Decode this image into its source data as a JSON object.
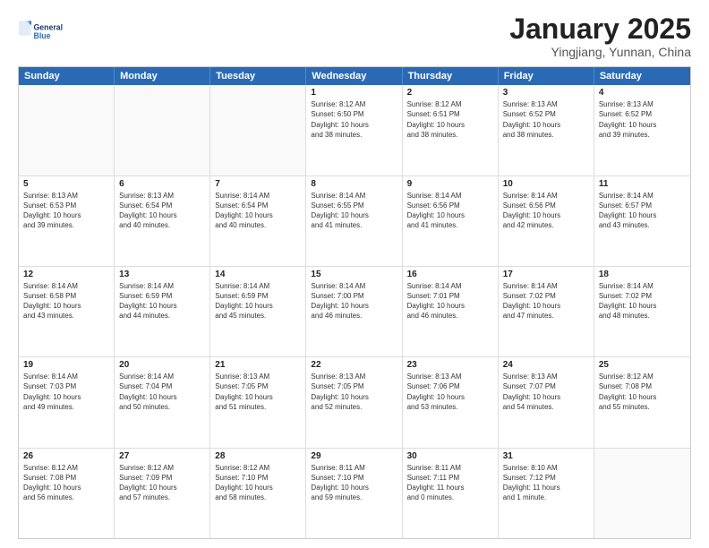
{
  "logo": {
    "line1": "General",
    "line2": "Blue"
  },
  "title": "January 2025",
  "subtitle": "Yingjiang, Yunnan, China",
  "header": {
    "days": [
      "Sunday",
      "Monday",
      "Tuesday",
      "Wednesday",
      "Thursday",
      "Friday",
      "Saturday"
    ]
  },
  "rows": [
    [
      {
        "day": "",
        "text": ""
      },
      {
        "day": "",
        "text": ""
      },
      {
        "day": "",
        "text": ""
      },
      {
        "day": "1",
        "text": "Sunrise: 8:12 AM\nSunset: 6:50 PM\nDaylight: 10 hours\nand 38 minutes."
      },
      {
        "day": "2",
        "text": "Sunrise: 8:12 AM\nSunset: 6:51 PM\nDaylight: 10 hours\nand 38 minutes."
      },
      {
        "day": "3",
        "text": "Sunrise: 8:13 AM\nSunset: 6:52 PM\nDaylight: 10 hours\nand 38 minutes."
      },
      {
        "day": "4",
        "text": "Sunrise: 8:13 AM\nSunset: 6:52 PM\nDaylight: 10 hours\nand 39 minutes."
      }
    ],
    [
      {
        "day": "5",
        "text": "Sunrise: 8:13 AM\nSunset: 6:53 PM\nDaylight: 10 hours\nand 39 minutes."
      },
      {
        "day": "6",
        "text": "Sunrise: 8:13 AM\nSunset: 6:54 PM\nDaylight: 10 hours\nand 40 minutes."
      },
      {
        "day": "7",
        "text": "Sunrise: 8:14 AM\nSunset: 6:54 PM\nDaylight: 10 hours\nand 40 minutes."
      },
      {
        "day": "8",
        "text": "Sunrise: 8:14 AM\nSunset: 6:55 PM\nDaylight: 10 hours\nand 41 minutes."
      },
      {
        "day": "9",
        "text": "Sunrise: 8:14 AM\nSunset: 6:56 PM\nDaylight: 10 hours\nand 41 minutes."
      },
      {
        "day": "10",
        "text": "Sunrise: 8:14 AM\nSunset: 6:56 PM\nDaylight: 10 hours\nand 42 minutes."
      },
      {
        "day": "11",
        "text": "Sunrise: 8:14 AM\nSunset: 6:57 PM\nDaylight: 10 hours\nand 43 minutes."
      }
    ],
    [
      {
        "day": "12",
        "text": "Sunrise: 8:14 AM\nSunset: 6:58 PM\nDaylight: 10 hours\nand 43 minutes."
      },
      {
        "day": "13",
        "text": "Sunrise: 8:14 AM\nSunset: 6:59 PM\nDaylight: 10 hours\nand 44 minutes."
      },
      {
        "day": "14",
        "text": "Sunrise: 8:14 AM\nSunset: 6:59 PM\nDaylight: 10 hours\nand 45 minutes."
      },
      {
        "day": "15",
        "text": "Sunrise: 8:14 AM\nSunset: 7:00 PM\nDaylight: 10 hours\nand 46 minutes."
      },
      {
        "day": "16",
        "text": "Sunrise: 8:14 AM\nSunset: 7:01 PM\nDaylight: 10 hours\nand 46 minutes."
      },
      {
        "day": "17",
        "text": "Sunrise: 8:14 AM\nSunset: 7:02 PM\nDaylight: 10 hours\nand 47 minutes."
      },
      {
        "day": "18",
        "text": "Sunrise: 8:14 AM\nSunset: 7:02 PM\nDaylight: 10 hours\nand 48 minutes."
      }
    ],
    [
      {
        "day": "19",
        "text": "Sunrise: 8:14 AM\nSunset: 7:03 PM\nDaylight: 10 hours\nand 49 minutes."
      },
      {
        "day": "20",
        "text": "Sunrise: 8:14 AM\nSunset: 7:04 PM\nDaylight: 10 hours\nand 50 minutes."
      },
      {
        "day": "21",
        "text": "Sunrise: 8:13 AM\nSunset: 7:05 PM\nDaylight: 10 hours\nand 51 minutes."
      },
      {
        "day": "22",
        "text": "Sunrise: 8:13 AM\nSunset: 7:05 PM\nDaylight: 10 hours\nand 52 minutes."
      },
      {
        "day": "23",
        "text": "Sunrise: 8:13 AM\nSunset: 7:06 PM\nDaylight: 10 hours\nand 53 minutes."
      },
      {
        "day": "24",
        "text": "Sunrise: 8:13 AM\nSunset: 7:07 PM\nDaylight: 10 hours\nand 54 minutes."
      },
      {
        "day": "25",
        "text": "Sunrise: 8:12 AM\nSunset: 7:08 PM\nDaylight: 10 hours\nand 55 minutes."
      }
    ],
    [
      {
        "day": "26",
        "text": "Sunrise: 8:12 AM\nSunset: 7:08 PM\nDaylight: 10 hours\nand 56 minutes."
      },
      {
        "day": "27",
        "text": "Sunrise: 8:12 AM\nSunset: 7:09 PM\nDaylight: 10 hours\nand 57 minutes."
      },
      {
        "day": "28",
        "text": "Sunrise: 8:12 AM\nSunset: 7:10 PM\nDaylight: 10 hours\nand 58 minutes."
      },
      {
        "day": "29",
        "text": "Sunrise: 8:11 AM\nSunset: 7:10 PM\nDaylight: 10 hours\nand 59 minutes."
      },
      {
        "day": "30",
        "text": "Sunrise: 8:11 AM\nSunset: 7:11 PM\nDaylight: 11 hours\nand 0 minutes."
      },
      {
        "day": "31",
        "text": "Sunrise: 8:10 AM\nSunset: 7:12 PM\nDaylight: 11 hours\nand 1 minute."
      },
      {
        "day": "",
        "text": ""
      }
    ]
  ]
}
